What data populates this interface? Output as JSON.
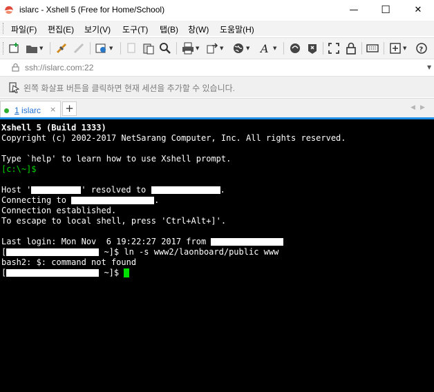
{
  "window": {
    "title": "islarc - Xshell 5 (Free for Home/School)",
    "icon": "xshell-app-icon",
    "minimize_icon": "minimize-icon",
    "maximize_icon": "maximize-icon",
    "close_icon": "close-icon",
    "minimize_glyph": "—",
    "maximize_glyph": "☐",
    "close_glyph": "✕"
  },
  "menu": {
    "items": [
      "파일(F)",
      "편집(E)",
      "보기(V)",
      "도구(T)",
      "탭(B)",
      "창(W)",
      "도움말(H)"
    ]
  },
  "toolbar": {
    "icons": [
      "new-session-icon",
      "open-folder-icon",
      "disconnect-icon",
      "reconnect-icon",
      "properties-icon",
      "copy-icon",
      "paste-icon",
      "find-icon",
      "print-icon",
      "transfer-icon",
      "globe-icon",
      "font-icon",
      "xftp-icon",
      "xmanager-icon",
      "fullscreen-icon",
      "lock-icon",
      "keyboard-icon",
      "add-icon",
      "help-icon"
    ]
  },
  "address": {
    "value": "ssh://islarc.com:22",
    "dropdown_glyph": "▼"
  },
  "hint": {
    "text": "왼쪽 화살표 버튼을 클릭하면 현재 세션을 추가할 수 있습니다."
  },
  "tabs": [
    {
      "number": "1",
      "label": "islarc",
      "close": "×",
      "status_color": "#2fae2f"
    }
  ],
  "new_tab_label": "+",
  "tab_nav": {
    "prev": "◀",
    "next": "▶"
  },
  "colors": {
    "accent": "#1e8ee6",
    "terminal_bg": "#000000",
    "terminal_fg": "#ffffff",
    "prompt_green": "#00d800"
  },
  "terminal": {
    "banner_title": "Xshell 5 (Build 1333)",
    "copyright": "Copyright (c) 2002-2017 NetSarang Computer, Inc. All rights reserved.",
    "help_line": "Type `help' to learn how to use Xshell prompt.",
    "local_prompt": "[c:\\~]$",
    "host_prefix": "Host '",
    "host_mid": "' resolved to ",
    "host_suffix": ".",
    "connecting_prefix": "Connecting to ",
    "connecting_suffix": ".",
    "established": "Connection established.",
    "escape_line": "To escape to local shell, press 'Ctrl+Alt+]'.",
    "last_login_prefix": "Last login: Mon Nov  6 19:22:27 2017 from ",
    "prompt_open": "[",
    "prompt_close_cmd": " ~]$ ln -s www2/laonboard/public www",
    "error_line": "bash2: $: command not found",
    "prompt_close": " ~]$ "
  }
}
